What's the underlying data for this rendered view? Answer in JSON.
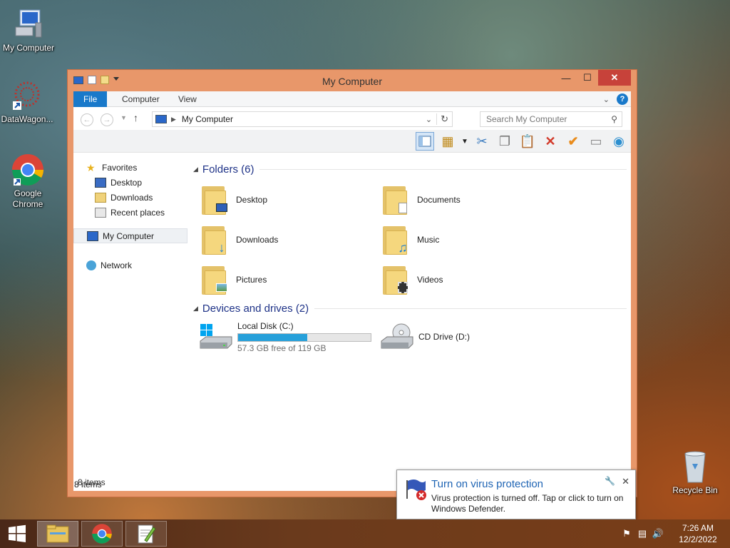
{
  "desktop": {
    "icons": [
      {
        "label": "My Computer"
      },
      {
        "label": "DataWagon..."
      },
      {
        "label": "Google Chrome"
      },
      {
        "label": "Recycle Bin"
      }
    ]
  },
  "window": {
    "title": "My Computer",
    "ribbon_tabs": [
      "File",
      "Computer",
      "View"
    ],
    "address": "My Computer",
    "search_placeholder": "Search My Computer",
    "help_label": "?",
    "navpane": {
      "favorites": "Favorites",
      "favorite_items": [
        "Desktop",
        "Downloads",
        "Recent places"
      ],
      "computer": "My Computer",
      "network": "Network"
    },
    "folders_header": "Folders (6)",
    "folders": [
      "Desktop",
      "Documents",
      "Downloads",
      "Music",
      "Pictures",
      "Videos"
    ],
    "devices_header": "Devices and drives (2)",
    "drives": [
      {
        "name": "Local Disk (C:)",
        "free": "57.3 GB free of 119 GB",
        "used_fraction": 0.52
      },
      {
        "name": "CD Drive (D:)"
      }
    ],
    "status_inner": "8 items",
    "status_outer": "8 items"
  },
  "notification": {
    "title": "Turn on virus protection",
    "message": "Virus protection is turned off. Tap or click to turn on Windows Defender."
  },
  "taskbar": {
    "time": "7:26 AM",
    "date": "12/2/2022"
  },
  "colors": {
    "window_frame": "#e8976a",
    "accent": "#1979ca",
    "close": "#c7423a",
    "drive_bar": "#26a0da",
    "group_header": "#1e3287"
  }
}
